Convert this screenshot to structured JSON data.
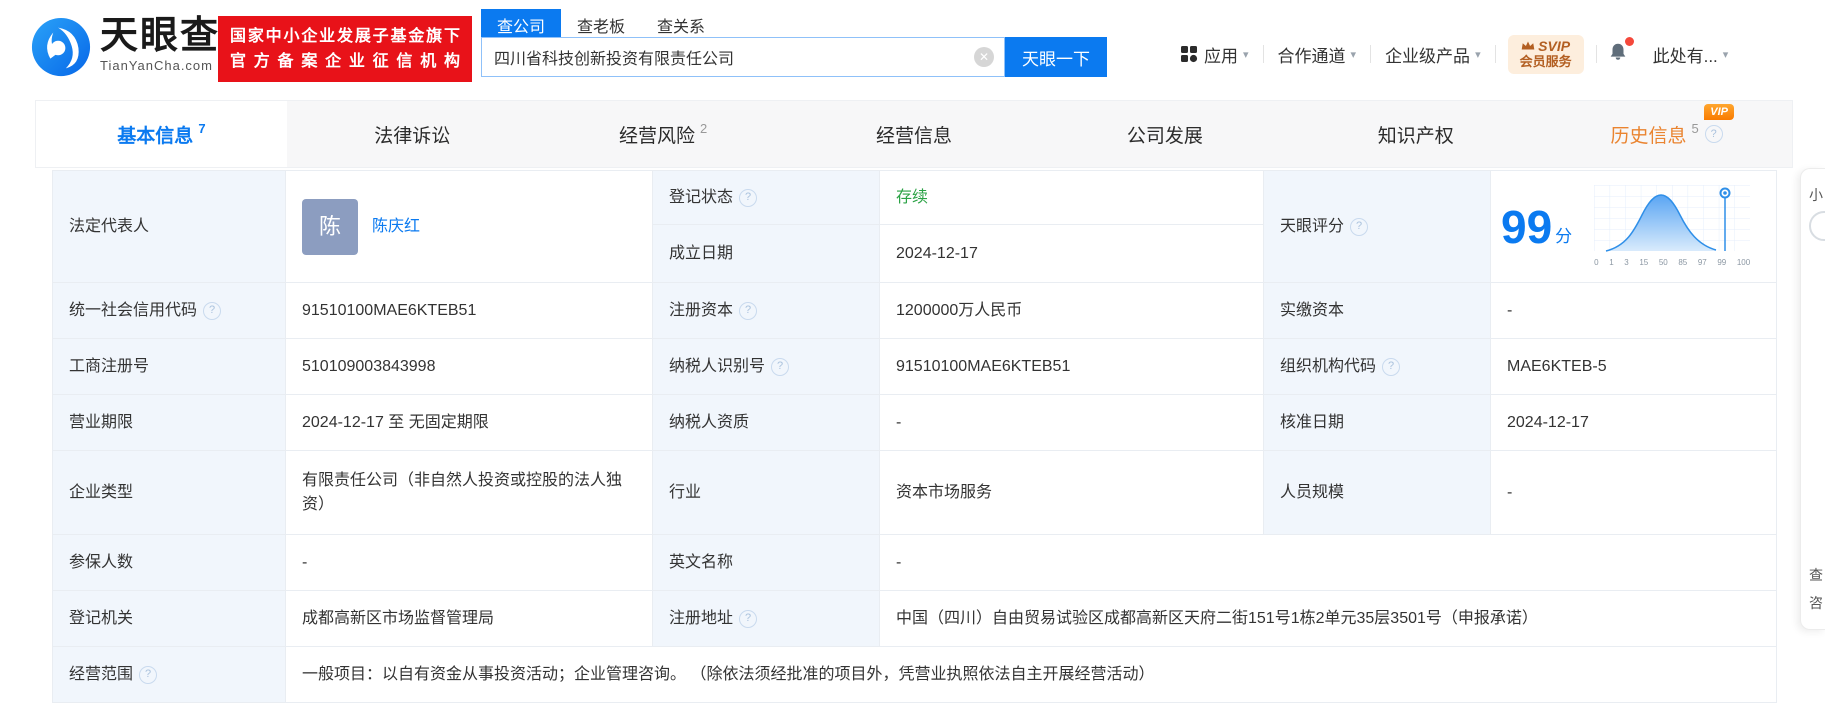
{
  "icons": {
    "help": "?",
    "clear": "✕",
    "caret": "▾"
  },
  "header": {
    "logo_brand": "天眼查",
    "logo_domain": "TianYanCha.com",
    "badge_line1": "国家中小企业发展子基金旗下",
    "badge_line2": "官方备案企业征信机构",
    "search_tabs": [
      {
        "label": "查公司",
        "active": true
      },
      {
        "label": "查老板",
        "active": false
      },
      {
        "label": "查关系",
        "active": false
      }
    ],
    "search_value": "四川省科技创新投资有限责任公司",
    "search_button": "天眼一下",
    "nav_app": "应用",
    "nav_partner": "合作通道",
    "nav_enterprise": "企业级产品",
    "svip_line1": "SVIP",
    "svip_line2": "会员服务",
    "nav_more": "此处有..."
  },
  "tabs": [
    {
      "label": "基本信息",
      "count": "7"
    },
    {
      "label": "法律诉讼",
      "count": ""
    },
    {
      "label": "经营风险",
      "count": "2"
    },
    {
      "label": "经营信息",
      "count": ""
    },
    {
      "label": "公司发展",
      "count": ""
    },
    {
      "label": "知识产权",
      "count": ""
    },
    {
      "label": "历史信息",
      "count": "5",
      "vip": "VIP"
    }
  ],
  "legal_rep": {
    "label": "法定代表人",
    "avatar": "陈",
    "name": "陈庆红"
  },
  "score": {
    "label": "天眼评分",
    "value": "99",
    "unit": "分"
  },
  "chart_data": {
    "type": "area",
    "title": "天眼评分",
    "value": 99,
    "axis_labels": [
      "0",
      "1",
      "3",
      "15",
      "50",
      "85",
      "97",
      "99",
      "100"
    ],
    "marker_at": 99
  },
  "fields": {
    "registration_status": {
      "label": "登记状态",
      "value": "存续"
    },
    "established": {
      "label": "成立日期",
      "value": "2024-12-17"
    },
    "credit_code": {
      "label": "统一社会信用代码",
      "value": "91510100MAE6KTEB51"
    },
    "registered_capital": {
      "label": "注册资本",
      "value": "1200000万人民币"
    },
    "paid_in_capital": {
      "label": "实缴资本",
      "value": "-"
    },
    "reg_number": {
      "label": "工商注册号",
      "value": "510109003843998"
    },
    "taxpayer_id": {
      "label": "纳税人识别号",
      "value": "91510100MAE6KTEB51"
    },
    "org_code": {
      "label": "组织机构代码",
      "value": "MAE6KTEB-5"
    },
    "business_term": {
      "label": "营业期限",
      "value": "2024-12-17 至 无固定期限"
    },
    "taxpayer_quality": {
      "label": "纳税人资质",
      "value": "-"
    },
    "approval_date": {
      "label": "核准日期",
      "value": "2024-12-17"
    },
    "company_type": {
      "label": "企业类型",
      "value": "有限责任公司（非自然人投资或控股的法人独资）"
    },
    "industry": {
      "label": "行业",
      "value": "资本市场服务"
    },
    "staff_size": {
      "label": "人员规模",
      "value": "-"
    },
    "insured_count": {
      "label": "参保人数",
      "value": "-"
    },
    "english_name": {
      "label": "英文名称",
      "value": "-"
    },
    "registration_authority": {
      "label": "登记机关",
      "value": "成都高新区市场监督管理局"
    },
    "registered_address": {
      "label": "注册地址",
      "value": "中国（四川）自由贸易试验区成都高新区天府二街151号1栋2单元35层3501号（申报承诺）"
    },
    "business_scope": {
      "label": "经营范围",
      "value": "一般项目：以自有资金从事投资活动；企业管理咨询。 （除依法须经批准的项目外，凭营业执照依法自主开展经营活动）"
    }
  },
  "right_panel": {
    "fragments": [
      "小",
      "查",
      "咨"
    ]
  },
  "colors": {
    "accent": "#0b7af0",
    "status_green": "#2ba245",
    "history_orange": "#ea8430",
    "badge_red": "#e81219"
  }
}
